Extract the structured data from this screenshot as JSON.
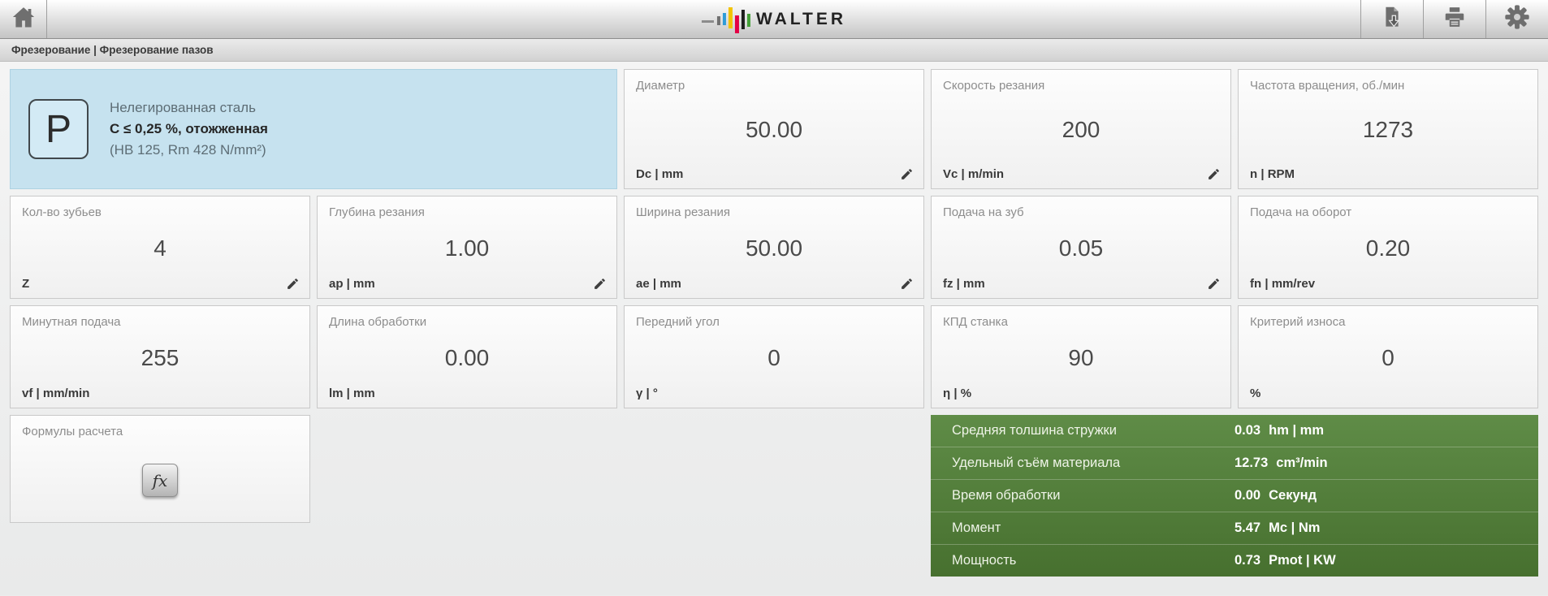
{
  "topbar": {
    "logo_text": "WALTER"
  },
  "icons": {
    "home-icon": "house",
    "export-icon": "document-download",
    "print-icon": "printer",
    "settings-icon": "gear",
    "pencil-icon": "pencil",
    "fx-icon": "fx"
  },
  "colors": {
    "material_card_bg": "#c6e2ef",
    "results_green": "#55803c",
    "logo_blue": "#2f9cd8",
    "logo_yellow": "#f3c300",
    "logo_red": "#e30045",
    "logo_green": "#44a038"
  },
  "breadcrumb": "Фрезерование | Фрезерование пазов",
  "material": {
    "symbol": "P",
    "line1": "Нелегированная сталь",
    "line2": "C ≤ 0,25 %, отожженная",
    "line3": "(HB 125, Rm 428 N/mm²)"
  },
  "cards": [
    {
      "label": "Диаметр",
      "value": "50.00",
      "unit": "Dc | mm",
      "editable": true
    },
    {
      "label": "Скорость резания",
      "value": "200",
      "unit": "Vc | m/min",
      "editable": true
    },
    {
      "label": "Частота вращения, об./мин",
      "value": "1273",
      "unit": "n | RPM",
      "editable": false
    },
    {
      "label": "Кол-во зубьев",
      "value": "4",
      "unit": "Z",
      "editable": true
    },
    {
      "label": "Глубина резания",
      "value": "1.00",
      "unit": "ap | mm",
      "editable": true
    },
    {
      "label": "Ширина резания",
      "value": "50.00",
      "unit": "ae | mm",
      "editable": true
    },
    {
      "label": "Подача на зуб",
      "value": "0.05",
      "unit": "fz | mm",
      "editable": true
    },
    {
      "label": "Подача на оборот",
      "value": "0.20",
      "unit": "fn | mm/rev",
      "editable": false
    },
    {
      "label": "Минутная подача",
      "value": "255",
      "unit": "vf | mm/min",
      "editable": false
    },
    {
      "label": "Длина обработки",
      "value": "0.00",
      "unit": "lm | mm",
      "editable": false
    },
    {
      "label": "Передний угол",
      "value": "0",
      "unit": "γ | °",
      "editable": false
    },
    {
      "label": "КПД станка",
      "value": "90",
      "unit": "η | %",
      "editable": false
    },
    {
      "label": "Критерий износа",
      "value": "0",
      "unit": "%",
      "editable": false
    }
  ],
  "formulas": {
    "label": "Формулы расчета",
    "button": "fx"
  },
  "results": {
    "rows": [
      {
        "label": "Средняя толшина стружки",
        "value": "0.03",
        "unit": "hm | mm"
      },
      {
        "label": "Удельный съём материала",
        "value": "12.73",
        "unit": "cm³/min"
      },
      {
        "label": "Время обработки",
        "value": "0.00",
        "unit": "Секунд"
      },
      {
        "label": "Момент",
        "value": "5.47",
        "unit": "Mc | Nm"
      },
      {
        "label": "Мощность",
        "value": "0.73",
        "unit": "Pmot | KW"
      }
    ]
  }
}
